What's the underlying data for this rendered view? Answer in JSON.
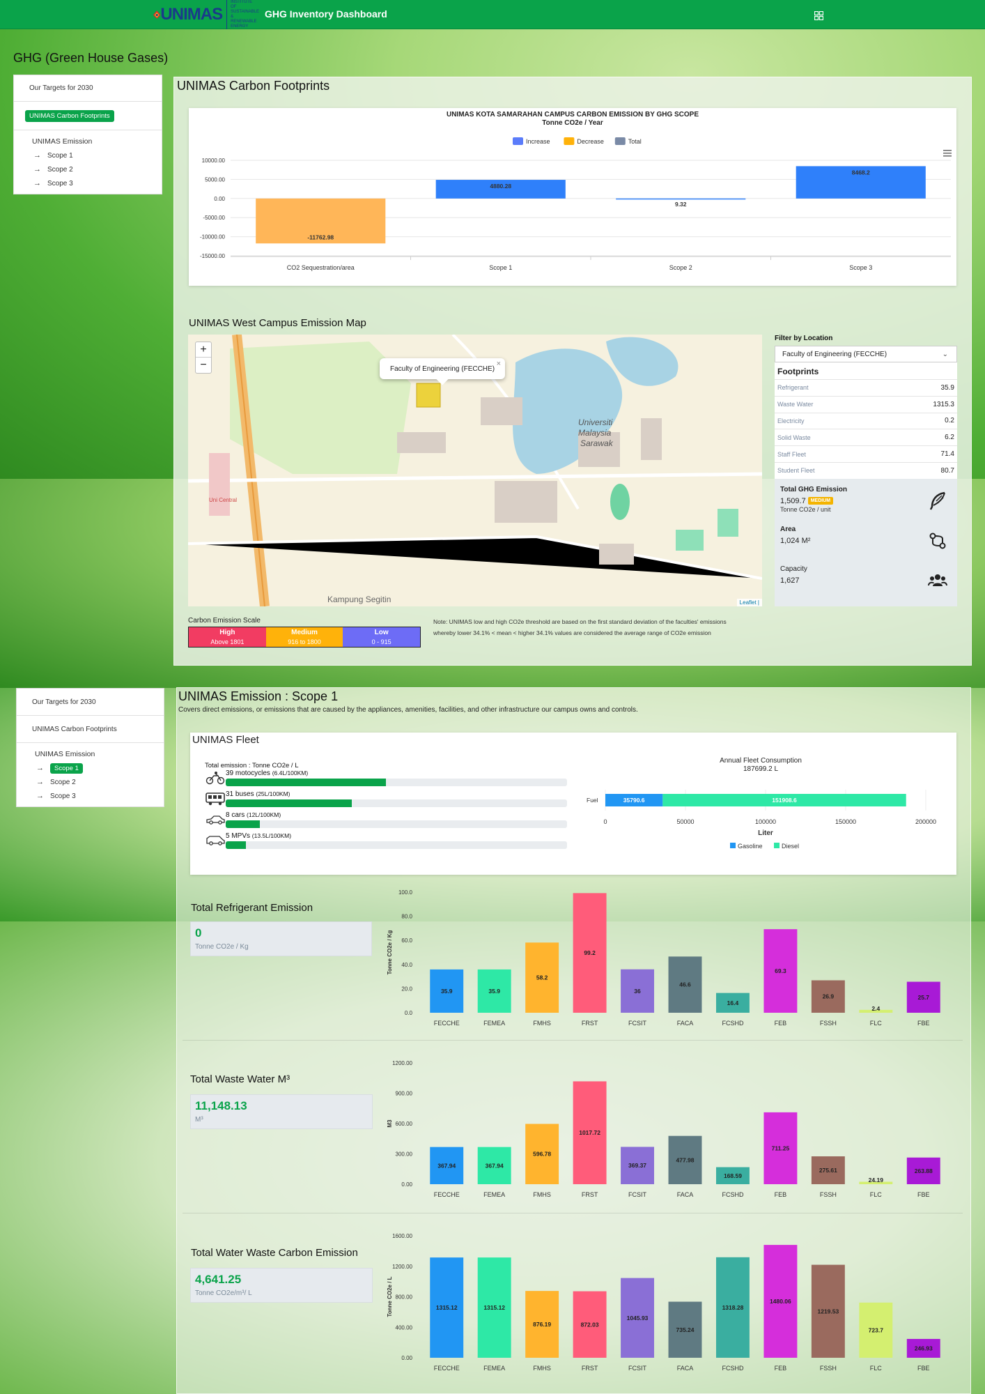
{
  "header": {
    "logo_text": "UNIMAS",
    "logo_sub": "INSTITUTE OF SUSTAINABLE & RENEWABLE ENERGY",
    "title": "GHG Inventory Dashboard"
  },
  "page_heading": "GHG (Green House Gases)",
  "nav": {
    "targets": "Our Targets for 2030",
    "footprints": "UNIMAS Carbon Footprints",
    "emission": "UNIMAS Emission",
    "scopes": [
      "Scope 1",
      "Scope 2",
      "Scope 3"
    ]
  },
  "footprints_section": {
    "title": "UNIMAS Carbon Footprints",
    "map_title": "UNIMAS West Campus Emission Map",
    "popup": "Faculty of Engineering (FECCHE)",
    "attribution": "Leaflet |"
  },
  "filter": {
    "label": "Filter by Location",
    "selected": "Faculty of Engineering (FECCHE)",
    "footprints_title": "Footprints",
    "rows": [
      {
        "k": "Refrigerant",
        "v": "35.9"
      },
      {
        "k": "Waste Water",
        "v": "1315.3"
      },
      {
        "k": "Electricity",
        "v": "0.2"
      },
      {
        "k": "Solid Waste",
        "v": "6.2"
      },
      {
        "k": "Staff Fleet",
        "v": "71.4"
      },
      {
        "k": "Student Fleet",
        "v": "80.7"
      }
    ],
    "total_label": "Total GHG Emission",
    "total_value": "1,509.7",
    "total_badge": "MEDIUM",
    "total_unit": "Tonne CO2e / unit",
    "area_label": "Area",
    "area_value": "1,024 M²",
    "capacity_label": "Capacity",
    "capacity_value": "1,627"
  },
  "scale": {
    "label": "Carbon Emission Scale",
    "segments": [
      {
        "name": "High",
        "range": "Above 1801",
        "color": "#f23c62"
      },
      {
        "name": "Medium",
        "range": "916 to 1800",
        "color": "#ffb20a"
      },
      {
        "name": "Low",
        "range": "0 - 915",
        "color": "#6d6cf6"
      }
    ],
    "note_line1": "Note: UNIMAS low and high CO2e threshold are based on the first standard deviation of the faculties' emissions",
    "note_line2": "whereby lower 34.1% < mean < higher 34.1% values are considered the average range of CO2e emission"
  },
  "scope1": {
    "title": "UNIMAS Emission : Scope 1",
    "desc": "Covers direct emissions, or emissions that are caused by the appliances, amenities, facilities, and other infrastructure our campus owns and controls.",
    "fleet_title": "UNIMAS Fleet",
    "fleet_head": "Total emission : Tonne CO2e / L",
    "fleet": [
      {
        "label": "39 motocycles",
        "detail": "(6.4L/100KM)",
        "pct": 47
      },
      {
        "label": "31 buses",
        "detail": "(25L/100KM)",
        "pct": 37
      },
      {
        "label": "8 cars",
        "detail": "(12L/100KM)",
        "pct": 10
      },
      {
        "label": "5 MPVs",
        "detail": "(13.5L/100KM)",
        "pct": 6
      }
    ],
    "refrigerant_title": "Total Refrigerant Emission",
    "refrigerant_value": "0",
    "refrigerant_unit": "Tonne CO2e / Kg",
    "wastewater_title": "Total Waste Water M³",
    "wastewater_value": "11,148.13",
    "wastewater_unit": "M³",
    "wwcarbon_title": "Total Water Waste Carbon Emission",
    "wwcarbon_value": "4,641.25",
    "wwcarbon_unit": "Tonne CO2e/m³/ L"
  },
  "chart_data": [
    {
      "type": "bar",
      "title": "UNIMAS KOTA SAMARAHAN CAMPUS CARBON EMISSION BY GHG SCOPE",
      "subtitle": "Tonne CO2e / Year",
      "legend": [
        "Increase",
        "Decrease",
        "Total"
      ],
      "legend_colors": [
        "#5b7cfa",
        "#ffb20a",
        "#7a8aa6"
      ],
      "categories": [
        "CO2 Sequestration/area",
        "Scope 1",
        "Scope 2",
        "Scope 3"
      ],
      "values": [
        -11762.98,
        4880.28,
        9.32,
        8468.2
      ],
      "labels": [
        "-11762.98",
        "4880.28",
        "9.32",
        "8468.2"
      ],
      "colors": [
        "#ffb658",
        "#2f80fa",
        "#2f80fa",
        "#2f80fa"
      ],
      "yticks": [
        "10000.00",
        "5000.00",
        "0.00",
        "-5000.00",
        "-10000.00",
        "-15000.00"
      ],
      "ylim": [
        -15000,
        10000
      ]
    },
    {
      "type": "bar",
      "title": "Annual Fleet Consumption",
      "subtitle": "187699.2 L",
      "categories": [
        "Fuel"
      ],
      "series": [
        {
          "name": "Gasoline",
          "values": [
            35790.6
          ],
          "color": "#2196f3"
        },
        {
          "name": "Diesel",
          "values": [
            151908.6
          ],
          "color": "#2ee8a6"
        }
      ],
      "labels": [
        "35790.6",
        "151908.6"
      ],
      "xlabel": "Liter",
      "xticks": [
        "0",
        "50000",
        "100000",
        "150000",
        "200000"
      ],
      "xlim": [
        0,
        200000
      ]
    },
    {
      "type": "bar",
      "ylabel": "Tonne CO2e / Kg",
      "categories": [
        "FECCHE",
        "FEMEA",
        "FMHS",
        "FRST",
        "FCSIT",
        "FACA",
        "FCSHD",
        "FEB",
        "FSSH",
        "FLC",
        "FBE"
      ],
      "values": [
        35.9,
        35.9,
        58.2,
        99.2,
        36,
        46.6,
        16.4,
        69.3,
        26.9,
        2.4,
        25.7
      ],
      "labels": [
        "35.9",
        "35.9",
        "58.2",
        "99.2",
        "36",
        "46.6",
        "16.4",
        "69.3",
        "26.9",
        "2.4",
        "25.7"
      ],
      "yticks": [
        "100.0",
        "80.0",
        "60.0",
        "40.0",
        "20.0",
        "0.0"
      ],
      "ylim": [
        0,
        100
      ]
    },
    {
      "type": "bar",
      "ylabel": "M3",
      "categories": [
        "FECCHE",
        "FEMEA",
        "FMHS",
        "FRST",
        "FCSIT",
        "FACA",
        "FCSHD",
        "FEB",
        "FSSH",
        "FLC",
        "FBE"
      ],
      "values": [
        367.94,
        367.94,
        596.78,
        1017.72,
        369.37,
        477.98,
        168.59,
        711.25,
        275.61,
        24.19,
        263.88
      ],
      "labels": [
        "367.94",
        "367.94",
        "596.78",
        "1017.72",
        "369.37",
        "477.98",
        "168.59",
        "711.25",
        "275.61",
        "24.19",
        "263.88"
      ],
      "yticks": [
        "1200.00",
        "900.00",
        "600.00",
        "300.00",
        "0.00"
      ],
      "ylim": [
        0,
        1200
      ]
    },
    {
      "type": "bar",
      "ylabel": "Tonne CO2e / L",
      "categories": [
        "FECCHE",
        "FEMEA",
        "FMHS",
        "FRST",
        "FCSIT",
        "FACA",
        "FCSHD",
        "FEB",
        "FSSH",
        "FLC",
        "FBE"
      ],
      "values": [
        1315.12,
        1315.12,
        876.19,
        872.03,
        1045.93,
        735.24,
        1318.28,
        1480.06,
        1219.53,
        723.7,
        246.93
      ],
      "labels": [
        "1315.12",
        "1315.12",
        "876.19",
        "872.03",
        "1045.93",
        "735.24",
        "1318.28",
        "1480.06",
        "1219.53",
        "723.7",
        "246.93"
      ],
      "yticks": [
        "1600.00",
        "1200.00",
        "800.00",
        "400.00",
        "0.00"
      ],
      "ylim": [
        0,
        1600
      ]
    }
  ],
  "faculty_colors": [
    "#2196f3",
    "#2ee8a6",
    "#ffb42e",
    "#ff5c7a",
    "#8a6fd6",
    "#5f7a82",
    "#3aaea0",
    "#d52edb",
    "#9a6a5e",
    "#d4ef70",
    "#a81ad6"
  ]
}
